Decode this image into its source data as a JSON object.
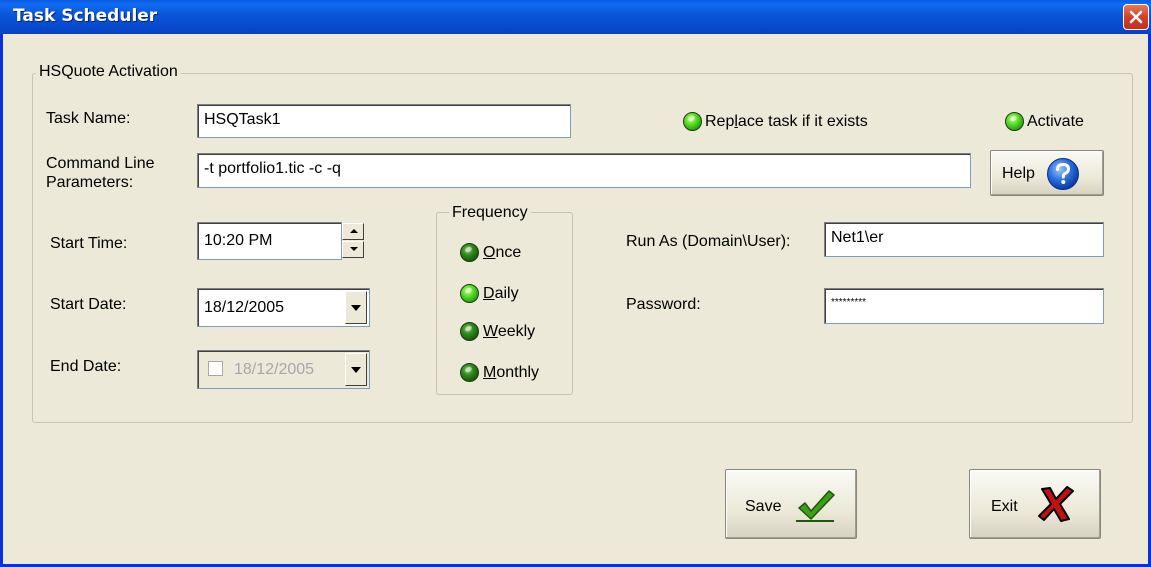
{
  "window": {
    "title": "Task Scheduler"
  },
  "group": {
    "legend": "HSQuote Activation"
  },
  "task_name": {
    "label": "Task Name:",
    "value": "HSQTask1"
  },
  "replace_task": {
    "label_pre": "Rep",
    "label_accel": "l",
    "label_post": "ace task if it exists",
    "state": "on"
  },
  "activate": {
    "label": "Activate",
    "state": "on"
  },
  "command_line": {
    "label_line1": "Command Line",
    "label_line2": "Parameters:",
    "value": "-t portfolio1.tic -c -q"
  },
  "help_button": {
    "label": "Help",
    "icon": "question-icon"
  },
  "start_time": {
    "label": "Start Time:",
    "value": "10:20 PM"
  },
  "start_date": {
    "label": "Start Date:",
    "value": "18/12/2005"
  },
  "end_date": {
    "label": "End Date:",
    "value": "18/12/2005",
    "checked": false,
    "enabled": false
  },
  "frequency": {
    "legend": "Frequency",
    "options": [
      {
        "accel": "O",
        "rest": "nce",
        "state": "off"
      },
      {
        "accel": "D",
        "rest": "aily",
        "state": "on"
      },
      {
        "accel": "W",
        "rest": "eekly",
        "state": "off"
      },
      {
        "accel": "M",
        "rest": "onthly",
        "state": "off"
      }
    ]
  },
  "run_as": {
    "label": "Run As (Domain\\User):",
    "value": "Net1\\er"
  },
  "password": {
    "label": "Password:",
    "value": "*********"
  },
  "save_button": {
    "label": "Save",
    "icon": "checkmark-icon",
    "accent": "#2f8a12"
  },
  "exit_button": {
    "label": "Exit",
    "icon": "x-icon",
    "accent": "#b01010"
  },
  "colors": {
    "titlebar": "#0a55d8",
    "dialog_bg": "#ece9d8",
    "close_button": "#d4402a"
  }
}
